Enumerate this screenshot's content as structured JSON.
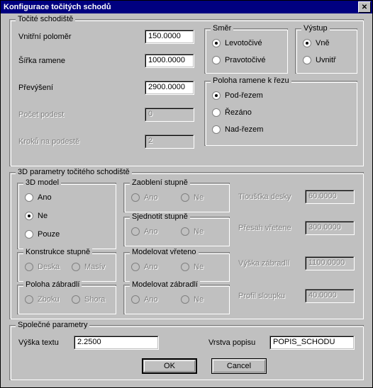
{
  "title": "Konfigurace točitých schodů",
  "g1": {
    "title": "Točité schodiště",
    "inner_r": "Vnitřní poloměr",
    "inner_r_v": "150.0000",
    "width": "Šířka ramene",
    "width_v": "1000.0000",
    "rise": "Převýšení",
    "rise_v": "2900.0000",
    "landings": "Počet podest",
    "landings_v": "0",
    "steps": "Kroků na podestě",
    "steps_v": "2"
  },
  "dir": {
    "title": "Směr",
    "left": "Levotočivé",
    "right": "Pravotočivé"
  },
  "out": {
    "title": "Výstup",
    "outside": "Vně",
    "inside": "Uvnitř"
  },
  "cut": {
    "title": "Poloha ramene k řezu",
    "below": "Pod-řezem",
    "thru": "Řezáno",
    "above": "Nad-řezem"
  },
  "g3d": {
    "title": "3D parametry točitého schodiště",
    "model": {
      "title": "3D model",
      "yes": "Ano",
      "no": "Ne",
      "only": "Pouze"
    },
    "rnd": {
      "title": "Zaoblení stupně",
      "yes": "Ano",
      "no": "Ne"
    },
    "uni": {
      "title": "Sjednotit stupně",
      "yes": "Ano",
      "no": "Ne"
    },
    "con": {
      "title": "Konstrukce stupně",
      "slab": "Deska",
      "solid": "Masív"
    },
    "rail": {
      "title": "Poloha zábradlí",
      "side": "Zboku",
      "top": "Shora"
    },
    "msp": {
      "title": "Modelovat vřeteno",
      "yes": "Ano",
      "no": "Ne"
    },
    "mra": {
      "title": "Modelovat zábradlí",
      "yes": "Ano",
      "no": "Ne"
    },
    "thk": "Tloušťka desky",
    "thk_v": "60.0000",
    "ovh": "Přesah vřetene",
    "ovh_v": "300.0000",
    "rh": "Výška zábradlí",
    "rh_v": "1100.0000",
    "pp": "Profil sloupku",
    "pp_v": "40.0000"
  },
  "common": {
    "title": "Společné parametry",
    "th": "Výška textu",
    "th_v": "2.2500",
    "layer": "Vrstva popisu",
    "layer_v": "POPIS_SCHODU"
  },
  "ok": "OK",
  "cancel": "Cancel"
}
